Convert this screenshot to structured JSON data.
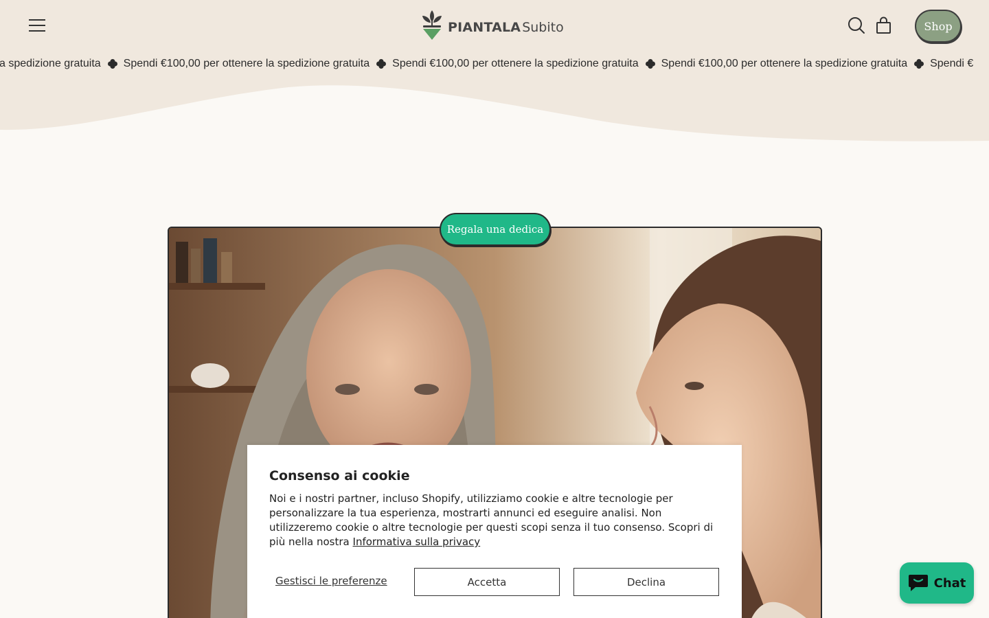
{
  "header": {
    "logo_main": "PIANTALA",
    "logo_sub": "Subito",
    "shop_label": "Shop"
  },
  "announcement": {
    "message": "Spendi €100,00 per ottenere la spedizione gratuita",
    "leading_fragment": "a spedizione gratuita",
    "trailing_fragment": "Spendi €"
  },
  "hero": {
    "badge_label": "Regala una dedica"
  },
  "cookie_banner": {
    "title": "Consenso ai cookie",
    "body": "Noi e i nostri partner, incluso Shopify, utilizziamo cookie e altre tecnologie per personalizzare la tua esperienza, mostrarti annunci ed eseguire analisi. Non utilizzeremo cookie o altre tecnologie per questi scopi senza il tuo consenso. Scopri di più nella nostra",
    "privacy_link": "Informativa sulla privacy",
    "manage_label": "Gestisci le preferenze",
    "accept_label": "Accetta",
    "decline_label": "Declina"
  },
  "chat": {
    "label": "Chat"
  },
  "colors": {
    "header_bg": "#f0e8de",
    "page_bg": "#fbf9f5",
    "shop_button": "#8ca083",
    "accent_green": "#20b888"
  },
  "icons": [
    "menu-icon",
    "logo-plant-icon",
    "search-icon",
    "shopping-bag-icon",
    "clover-icon",
    "chat-bubble-icon"
  ]
}
